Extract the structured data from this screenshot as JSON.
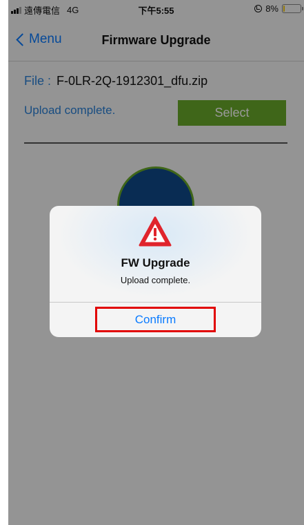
{
  "status_bar": {
    "carrier": "遠傳電信",
    "network": "4G",
    "time": "下午5:55",
    "battery_percent": "8%",
    "battery_level": 0.08
  },
  "nav": {
    "back_label": "Menu",
    "title": "Firmware Upgrade"
  },
  "content": {
    "file_label": "File :",
    "file_name": "F-0LR-2Q-1912301_dfu.zip",
    "status_text": "Upload complete.",
    "select_label": "Select"
  },
  "alert": {
    "title": "FW Upgrade",
    "message": "Upload complete.",
    "confirm_label": "Confirm"
  },
  "colors": {
    "accent_blue": "#0a7bff",
    "select_green": "#6aab2a",
    "circle_fill": "#0f4a8a",
    "warning_red": "#e0242c",
    "highlight_red": "#e10000"
  },
  "icons": {
    "back": "chevron-left-icon",
    "warning": "warning-triangle-icon",
    "orientation_lock": "orientation-lock-icon",
    "battery": "battery-icon",
    "signal": "signal-icon"
  }
}
